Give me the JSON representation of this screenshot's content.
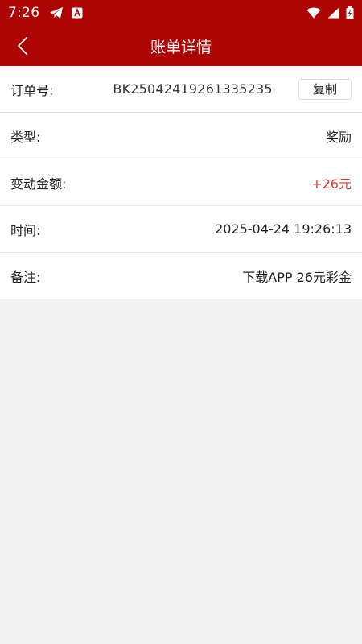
{
  "status_bar": {
    "time": "7:26",
    "left_icons": [
      "telegram-icon",
      "app-notification-icon"
    ],
    "right_icons": [
      "wifi-icon",
      "cell-signal-icon",
      "battery-icon"
    ]
  },
  "header": {
    "title": "账单详情",
    "back_icon": "chevron-left-icon",
    "background": "#ad0404"
  },
  "details": {
    "order": {
      "label": "订单号:",
      "value": "BK25042419261335235",
      "copy_label": "复制"
    },
    "type": {
      "label": "类型:",
      "value": "奖励"
    },
    "amount": {
      "label": "变动金额:",
      "value": "+26元",
      "color": "#d13c31"
    },
    "time": {
      "label": "时间:",
      "value": "2025-04-24 19:26:13"
    },
    "remark": {
      "label": "备注:",
      "value": "下载APP 26元彩金"
    }
  }
}
